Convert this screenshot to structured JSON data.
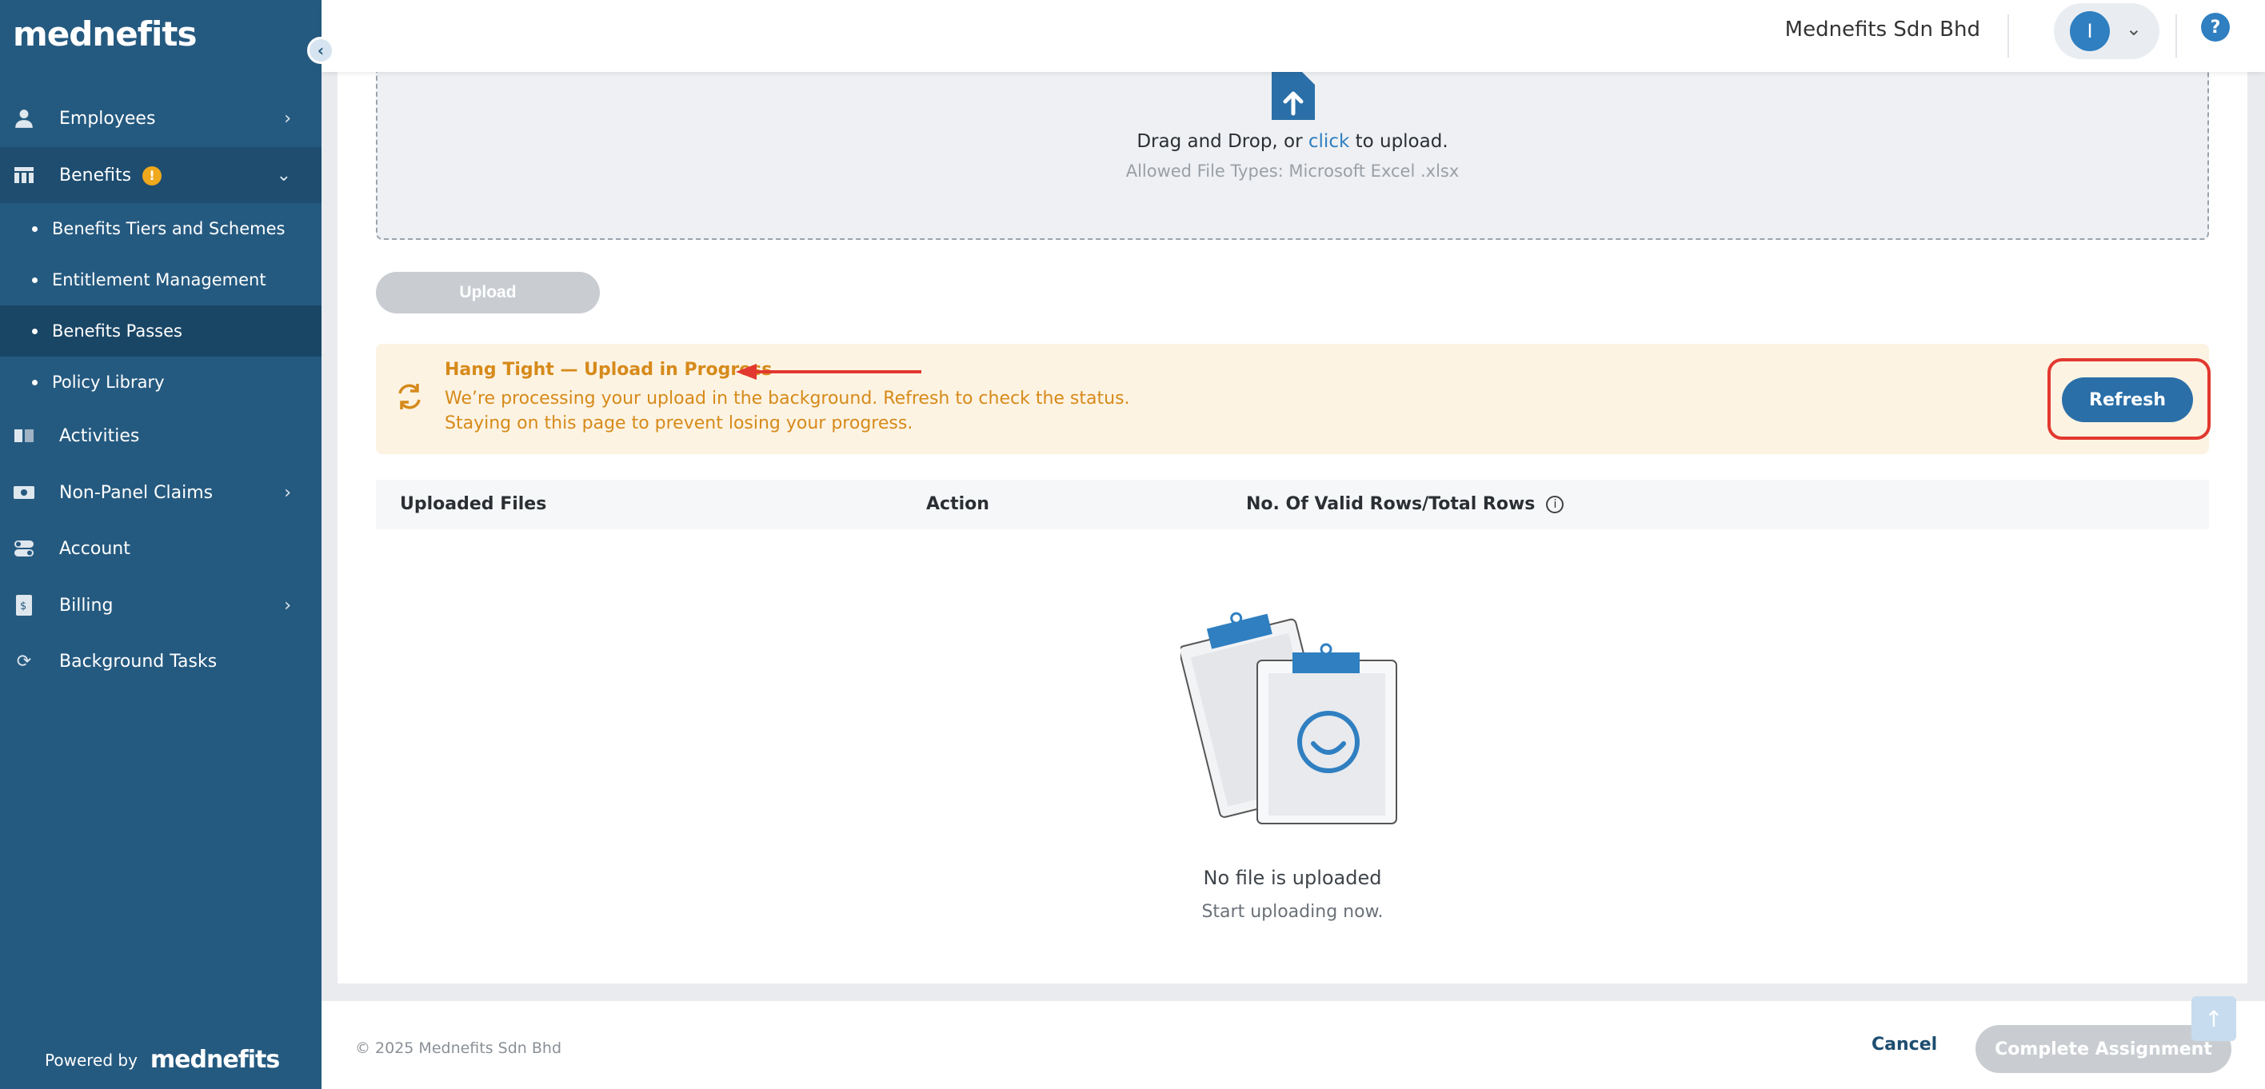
{
  "brand": {
    "logo_text": "mednefits",
    "powered_by": "Powered by",
    "powered_logo": "mednefits"
  },
  "sidebar": {
    "collapse_icon": "chevron-left-icon",
    "items": [
      {
        "label": "Employees",
        "icon": "person-icon",
        "has_chevron": true
      },
      {
        "label": "Benefits",
        "icon": "table-icon",
        "badge": "!",
        "expanded": true
      },
      {
        "label": "Activities",
        "icon": "book-icon"
      },
      {
        "label": "Non-Panel Claims",
        "icon": "cash-icon",
        "has_chevron": true
      },
      {
        "label": "Account",
        "icon": "toggle-icon"
      },
      {
        "label": "Billing",
        "icon": "invoice-icon",
        "has_chevron": true
      },
      {
        "label": "Background Tasks",
        "icon": "sync-icon"
      }
    ],
    "benefits_sub": [
      {
        "label": "Benefits Tiers and Schemes"
      },
      {
        "label": "Entitlement Management"
      },
      {
        "label": "Benefits Passes",
        "active": true
      },
      {
        "label": "Policy Library"
      }
    ]
  },
  "header": {
    "company": "Mednefits Sdn Bhd",
    "avatar_initial": "I",
    "help_label": "?"
  },
  "dropzone": {
    "text_before": "Drag and Drop, or ",
    "click_text": "click",
    "text_after": " to upload.",
    "allowed": "Allowed File Types: Microsoft Excel .xlsx"
  },
  "upload_button": "Upload",
  "alert": {
    "title": "Hang Tight — Upload in Progress",
    "line1": "We’re processing your upload in the background. Refresh to check the status.",
    "line2": "Staying on this page to prevent losing your progress.",
    "refresh_label": "Refresh",
    "color": "#d68a1a"
  },
  "table": {
    "columns": [
      "Uploaded Files",
      "Action",
      "No. Of Valid Rows/Total Rows"
    ],
    "rows": []
  },
  "empty_state": {
    "title": "No file is uploaded",
    "subtitle": "Start uploading now."
  },
  "footer": {
    "copyright": "© 2025 Mednefits Sdn Bhd",
    "cancel": "Cancel",
    "complete": "Complete Assignment"
  },
  "colors": {
    "sidebar": "#255a80",
    "primary": "#2a6fa8",
    "annotation": "#e2382f"
  }
}
